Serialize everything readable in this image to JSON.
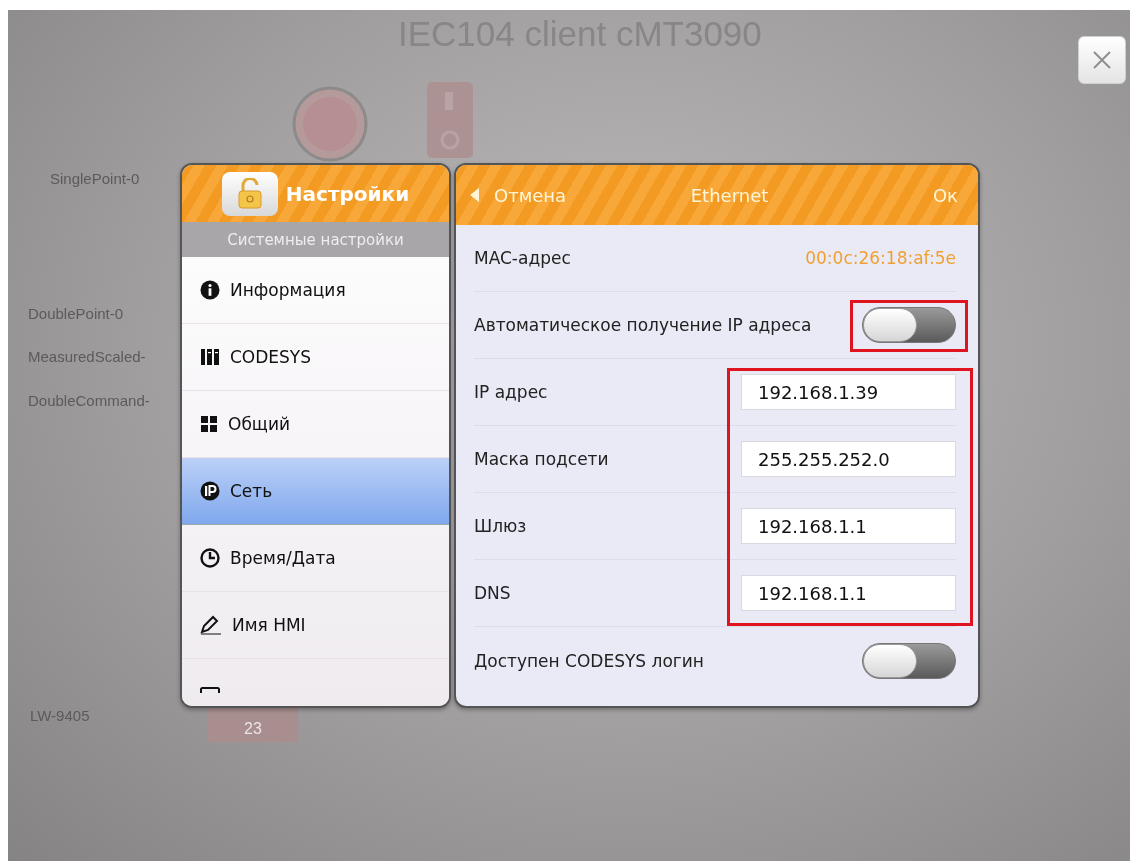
{
  "background": {
    "title": "IEC104 client cMT3090",
    "labels": [
      "SinglePoint-0",
      "DoublePoint-0",
      "MeasuredScaled-",
      "DoubleCommand-",
      "LW-9405"
    ],
    "value": "23"
  },
  "sidebar": {
    "title": "Настройки",
    "subtitle": "Системные настройки",
    "items": [
      {
        "label": "Информация",
        "selected": false
      },
      {
        "label": "CODESYS",
        "selected": false
      },
      {
        "label": "Общий",
        "selected": false
      },
      {
        "label": "Сеть",
        "selected": true
      },
      {
        "label": "Время/Дата",
        "selected": false
      },
      {
        "label": "Имя HMI",
        "selected": false
      },
      {
        "selected": false
      }
    ]
  },
  "panel": {
    "back": "Отмена",
    "title": "Ethernet",
    "ok": "Ок",
    "rows": [
      {
        "kind": "readout",
        "label": "MAC-адрес",
        "value": "00:0c:26:18:af:5e"
      },
      {
        "kind": "toggle",
        "label": "Автоматическое получение IP адреса",
        "on": false,
        "highlighted": true
      },
      {
        "kind": "field",
        "label": "IP адрес",
        "value": "192.168.1.39",
        "highlighted": true
      },
      {
        "kind": "field",
        "label": "Маска подсети",
        "value": "255.255.252.0",
        "highlighted": true
      },
      {
        "kind": "field",
        "label": "Шлюз",
        "value": "192.168.1.1",
        "highlighted": true
      },
      {
        "kind": "field",
        "label": "DNS",
        "value": "192.168.1.1",
        "highlighted": true
      },
      {
        "kind": "toggle",
        "label": "Доступен CODESYS логин",
        "on": false
      }
    ]
  }
}
